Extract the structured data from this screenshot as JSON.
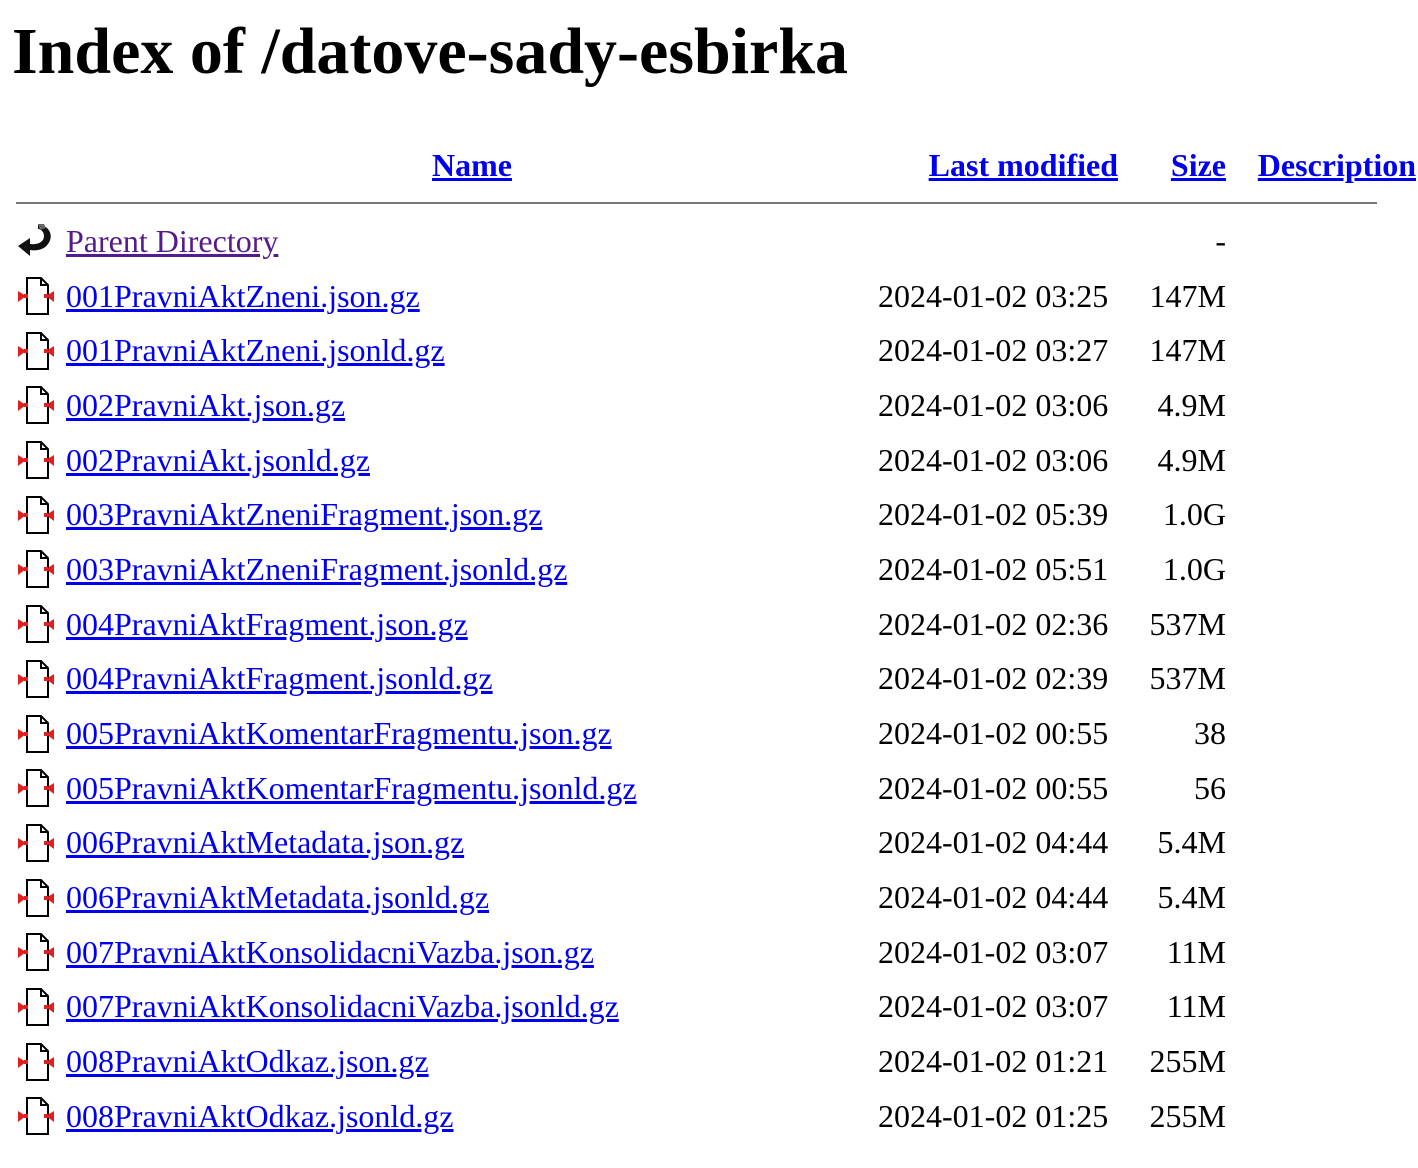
{
  "title": "Index of /datove-sady-esbirka",
  "headers": {
    "name": "Name",
    "last_modified": "Last modified",
    "size": "Size",
    "description": "Description"
  },
  "parent": {
    "label": "Parent Directory",
    "size": "-",
    "icon": "back-icon"
  },
  "files": [
    {
      "name": "001PravniAktZneni.json.gz",
      "modified": "2024-01-02 03:25",
      "size": "147M"
    },
    {
      "name": "001PravniAktZneni.jsonld.gz",
      "modified": "2024-01-02 03:27",
      "size": "147M"
    },
    {
      "name": "002PravniAkt.json.gz",
      "modified": "2024-01-02 03:06",
      "size": "4.9M"
    },
    {
      "name": "002PravniAkt.jsonld.gz",
      "modified": "2024-01-02 03:06",
      "size": "4.9M"
    },
    {
      "name": "003PravniAktZneniFragment.json.gz",
      "modified": "2024-01-02 05:39",
      "size": "1.0G"
    },
    {
      "name": "003PravniAktZneniFragment.jsonld.gz",
      "modified": "2024-01-02 05:51",
      "size": "1.0G"
    },
    {
      "name": "004PravniAktFragment.json.gz",
      "modified": "2024-01-02 02:36",
      "size": "537M"
    },
    {
      "name": "004PravniAktFragment.jsonld.gz",
      "modified": "2024-01-02 02:39",
      "size": "537M"
    },
    {
      "name": "005PravniAktKomentarFragmentu.json.gz",
      "modified": "2024-01-02 00:55",
      "size": "38"
    },
    {
      "name": "005PravniAktKomentarFragmentu.jsonld.gz",
      "modified": "2024-01-02 00:55",
      "size": "56"
    },
    {
      "name": "006PravniAktMetadata.json.gz",
      "modified": "2024-01-02 04:44",
      "size": "5.4M"
    },
    {
      "name": "006PravniAktMetadata.jsonld.gz",
      "modified": "2024-01-02 04:44",
      "size": "5.4M"
    },
    {
      "name": "007PravniAktKonsolidacniVazba.json.gz",
      "modified": "2024-01-02 03:07",
      "size": "11M"
    },
    {
      "name": "007PravniAktKonsolidacniVazba.jsonld.gz",
      "modified": "2024-01-02 03:07",
      "size": "11M"
    },
    {
      "name": "008PravniAktOdkaz.json.gz",
      "modified": "2024-01-02 01:21",
      "size": "255M"
    },
    {
      "name": "008PravniAktOdkaz.jsonld.gz",
      "modified": "2024-01-02 01:25",
      "size": "255M"
    }
  ]
}
